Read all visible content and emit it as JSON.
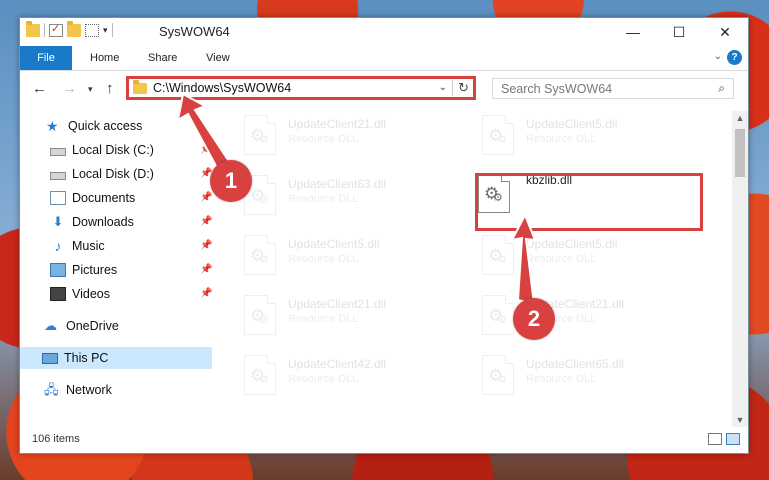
{
  "window": {
    "title": "SysWOW64",
    "controls": {
      "minimize": "—",
      "maximize": "☐",
      "close": "✕"
    }
  },
  "ribbon": {
    "tabs": [
      "File",
      "Home",
      "Share",
      "View"
    ],
    "expand_glyph": "⌄",
    "help_glyph": "?"
  },
  "address": {
    "path": "C:\\Windows\\SysWOW64",
    "search_placeholder": "Search SysWOW64"
  },
  "nav_pane": {
    "items": [
      {
        "label": "Quick access",
        "icon": "star-icon"
      },
      {
        "label": "Local Disk (C:)",
        "icon": "drive-icon",
        "pinned": true
      },
      {
        "label": "Local Disk (D:)",
        "icon": "drive-icon",
        "pinned": true
      },
      {
        "label": "Documents",
        "icon": "documents-icon",
        "pinned": true
      },
      {
        "label": "Downloads",
        "icon": "downloads-icon",
        "pinned": true
      },
      {
        "label": "Music",
        "icon": "music-icon",
        "pinned": true
      },
      {
        "label": "Pictures",
        "icon": "pictures-icon",
        "pinned": true
      },
      {
        "label": "Videos",
        "icon": "videos-icon",
        "pinned": true
      },
      {
        "label": "OneDrive",
        "icon": "onedrive-icon"
      },
      {
        "label": "This PC",
        "icon": "this-pc-icon",
        "selected": true
      },
      {
        "label": "Network",
        "icon": "network-icon"
      }
    ]
  },
  "files": {
    "left_column": [
      {
        "name": "UpdateClient21.dll",
        "type": "Resource DLL"
      },
      {
        "name": "UpdateClient63.dll",
        "type": "Resource DLL"
      },
      {
        "name": "UpdateClient5.dll",
        "type": "Resource DLL"
      },
      {
        "name": "UpdateClient21.dll",
        "type": "Resource DLL"
      },
      {
        "name": "UpdateClient42.dll",
        "type": "Resource DLL"
      }
    ],
    "right_column": [
      {
        "name": "UpdateClient5.dll",
        "type": "Resource DLL"
      },
      {
        "name": "kbzlib.dll",
        "type": "",
        "highlighted": true
      },
      {
        "name": "UpdateClient5.dll",
        "type": "Resource DLL"
      },
      {
        "name": "UpdateClient21.dll",
        "type": "Resource DLL"
      },
      {
        "name": "UpdateClient65.dll",
        "type": "Resource DLL"
      }
    ]
  },
  "status": {
    "item_count": "106 items"
  },
  "callouts": {
    "step1": "1",
    "step2": "2"
  },
  "colors": {
    "accent": "#1979ca",
    "highlight": "#d94040",
    "selected": "#cce8ff"
  }
}
